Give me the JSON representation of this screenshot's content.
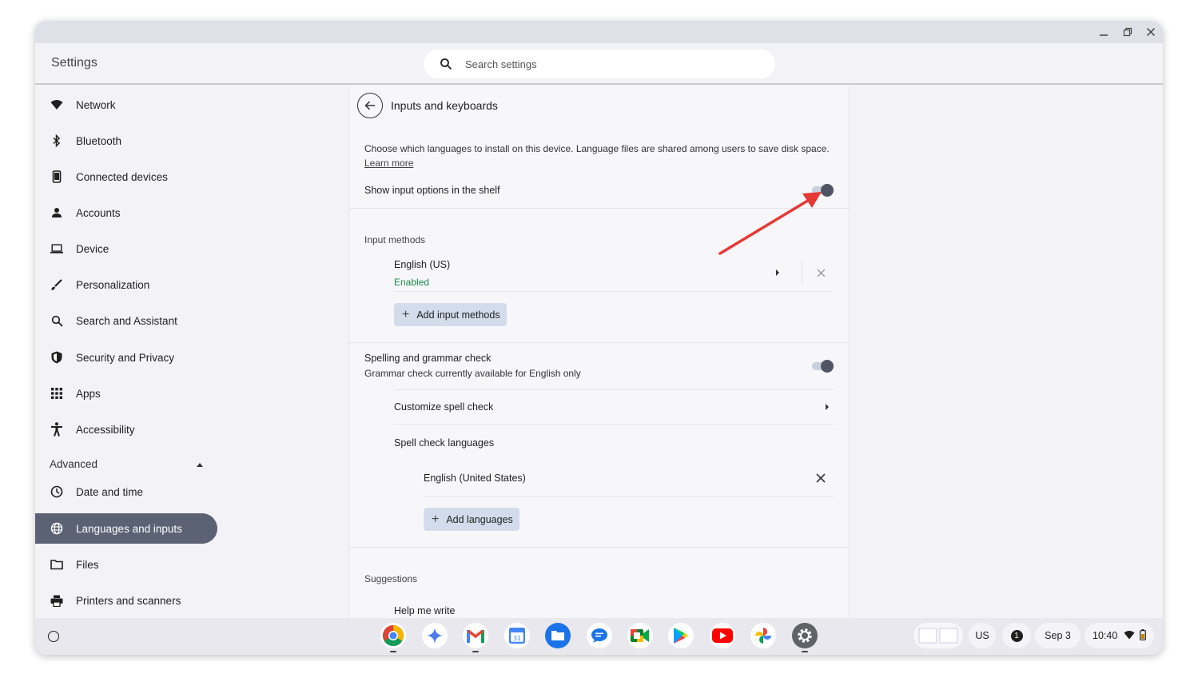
{
  "window": {
    "title": "Settings",
    "controls": {
      "minimize": "minimize-icon",
      "restore": "restore-icon",
      "close": "close-icon"
    }
  },
  "search": {
    "placeholder": "Search settings"
  },
  "sidebar": {
    "items": [
      {
        "label": "Network",
        "icon": "wifi-icon"
      },
      {
        "label": "Bluetooth",
        "icon": "bluetooth-icon"
      },
      {
        "label": "Connected devices",
        "icon": "phone-icon"
      },
      {
        "label": "Accounts",
        "icon": "person-icon"
      },
      {
        "label": "Device",
        "icon": "laptop-icon"
      },
      {
        "label": "Personalization",
        "icon": "brush-icon"
      },
      {
        "label": "Search and Assistant",
        "icon": "search-icon"
      },
      {
        "label": "Security and Privacy",
        "icon": "shield-icon"
      },
      {
        "label": "Apps",
        "icon": "apps-grid-icon"
      },
      {
        "label": "Accessibility",
        "icon": "accessibility-icon"
      }
    ],
    "advanced_label": "Advanced",
    "advanced_items": [
      {
        "label": "Date and time",
        "icon": "clock-icon"
      },
      {
        "label": "Languages and inputs",
        "icon": "globe-icon",
        "active": true
      },
      {
        "label": "Files",
        "icon": "folder-icon"
      },
      {
        "label": "Printers and scanners",
        "icon": "printer-icon"
      }
    ]
  },
  "main": {
    "title": "Inputs and keyboards",
    "description": "Choose which languages to install on this device. Language files are shared among users to save disk space.",
    "learn_more": "Learn more",
    "show_input_options": {
      "label": "Show input options in the shelf",
      "on": true
    },
    "input_methods": {
      "section_label": "Input methods",
      "items": [
        {
          "name": "English (US)",
          "status": "Enabled"
        }
      ],
      "add_button": "Add input methods"
    },
    "spelling": {
      "label": "Spelling and grammar check",
      "sublabel": "Grammar check currently available for English only",
      "on": true,
      "customize": "Customize spell check",
      "languages_label": "Spell check languages",
      "languages": [
        "English (United States)"
      ],
      "add_button": "Add languages"
    },
    "suggestions": {
      "section_label": "Suggestions",
      "items": [
        "Help me write"
      ]
    }
  },
  "shelf": {
    "apps": [
      "Chrome",
      "Gemini",
      "Gmail",
      "Calendar",
      "Files",
      "Messages",
      "Meet",
      "Play Store",
      "YouTube",
      "Photos",
      "Settings"
    ],
    "keyboard_layout": "US",
    "notification_count": "1",
    "date": "Sep 3",
    "time": "10:40"
  },
  "colors": {
    "active_nav": "#5b6274",
    "accent_arrow": "#e53935",
    "enabled_text": "#1a8a4a",
    "button_bg": "#d3dcea"
  }
}
